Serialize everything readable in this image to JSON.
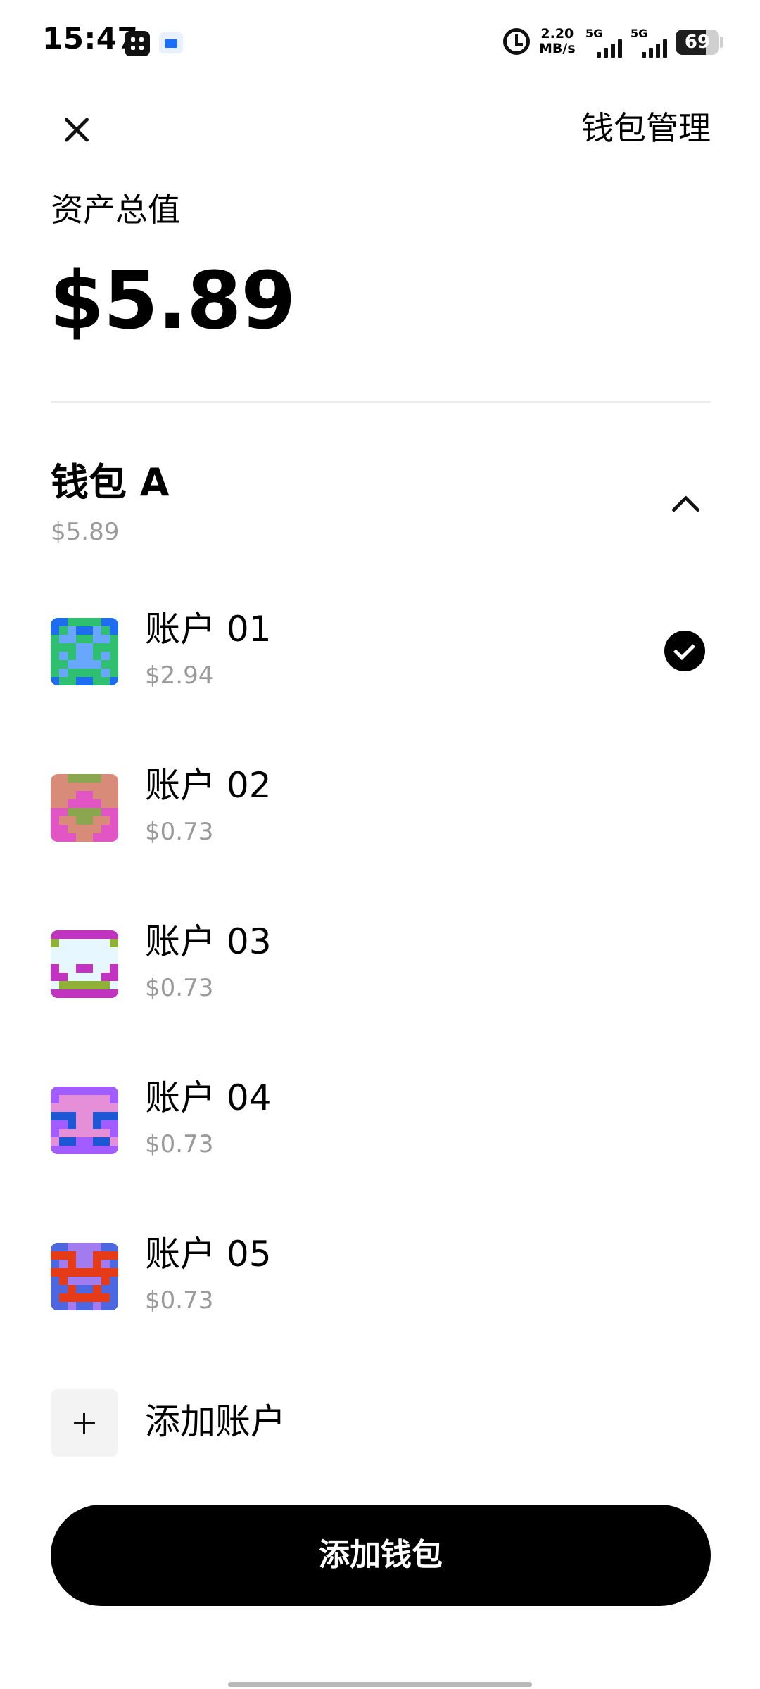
{
  "status_bar": {
    "time": "15:47",
    "net_speed_value": "2.20",
    "net_speed_unit": "MB/s",
    "signal_1_tag": "5G",
    "signal_2_tag": "5G",
    "battery_level": "69",
    "battery_fraction": 0.69,
    "icons": [
      "grid-app-icon",
      "blue-app-icon",
      "alarm-icon",
      "signal-icon",
      "battery-icon"
    ]
  },
  "header": {
    "close_icon": "close-icon",
    "manage_label": "钱包管理"
  },
  "summary": {
    "total_label": "资产总值",
    "total_value": "$5.89"
  },
  "wallet": {
    "name": "钱包 A",
    "total": "$5.89",
    "expanded": true,
    "accounts": [
      {
        "name": "账户 01",
        "balance": "$2.94",
        "selected": true
      },
      {
        "name": "账户 02",
        "balance": "$0.73",
        "selected": false
      },
      {
        "name": "账户 03",
        "balance": "$0.73",
        "selected": false
      },
      {
        "name": "账户 04",
        "balance": "$0.73",
        "selected": false
      },
      {
        "name": "账户 05",
        "balance": "$0.73",
        "selected": false
      }
    ]
  },
  "add_account_label": "添加账户",
  "add_wallet_label": "添加钱包",
  "avatar_colors": [
    {
      "bg": "#1e6cf0",
      "fg": "#2fbf71",
      "accent": "#69a7ff"
    },
    {
      "bg": "#d98b79",
      "fg": "#e155c4",
      "accent": "#8aa74f"
    },
    {
      "bg": "#8fb236",
      "fg": "#c034c0",
      "accent": "#e6f7ff"
    },
    {
      "bg": "#1e57d6",
      "fg": "#a35cff",
      "accent": "#e58fd9"
    },
    {
      "bg": "#e53b17",
      "fg": "#4c67df",
      "accent": "#a27bf0"
    }
  ]
}
